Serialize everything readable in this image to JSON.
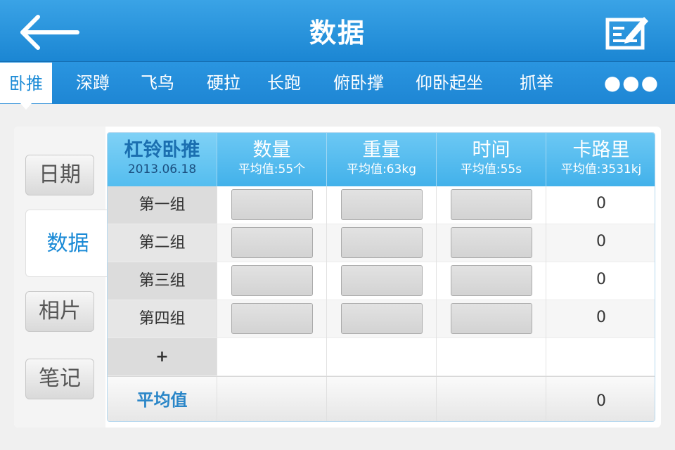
{
  "header": {
    "title": "数据",
    "back_icon": "back-arrow-icon",
    "edit_icon": "edit-icon"
  },
  "tabs": [
    {
      "label": "卧推",
      "active": true
    },
    {
      "label": "深蹲"
    },
    {
      "label": "飞鸟"
    },
    {
      "label": "硬拉"
    },
    {
      "label": "长跑"
    },
    {
      "label": "俯卧撑"
    },
    {
      "label": "仰卧起坐"
    },
    {
      "label": "抓举"
    }
  ],
  "more_label": "●●●",
  "sidebar": [
    {
      "label": "日期"
    },
    {
      "label": "数据",
      "active": true
    },
    {
      "label": "相片"
    },
    {
      "label": "笔记"
    }
  ],
  "table": {
    "exercise": "杠铃卧推",
    "date": "2013.06.18",
    "columns": [
      {
        "title": "数量",
        "avg": "平均值:55个"
      },
      {
        "title": "重量",
        "avg": "平均值:63kg"
      },
      {
        "title": "时间",
        "avg": "平均值:55s"
      },
      {
        "title": "卡路里",
        "avg": "平均值:3531kj"
      }
    ],
    "rows": [
      {
        "label": "第一组",
        "calories": "0"
      },
      {
        "label": "第二组",
        "calories": "0"
      },
      {
        "label": "第三组",
        "calories": "0"
      },
      {
        "label": "第四组",
        "calories": "0"
      }
    ],
    "add_label": "+",
    "avg_label": "平均值",
    "avg_calories": "0"
  },
  "colors": {
    "accent": "#1a8ad6",
    "header": "#2a95e0",
    "table_header": "#55bcef"
  }
}
